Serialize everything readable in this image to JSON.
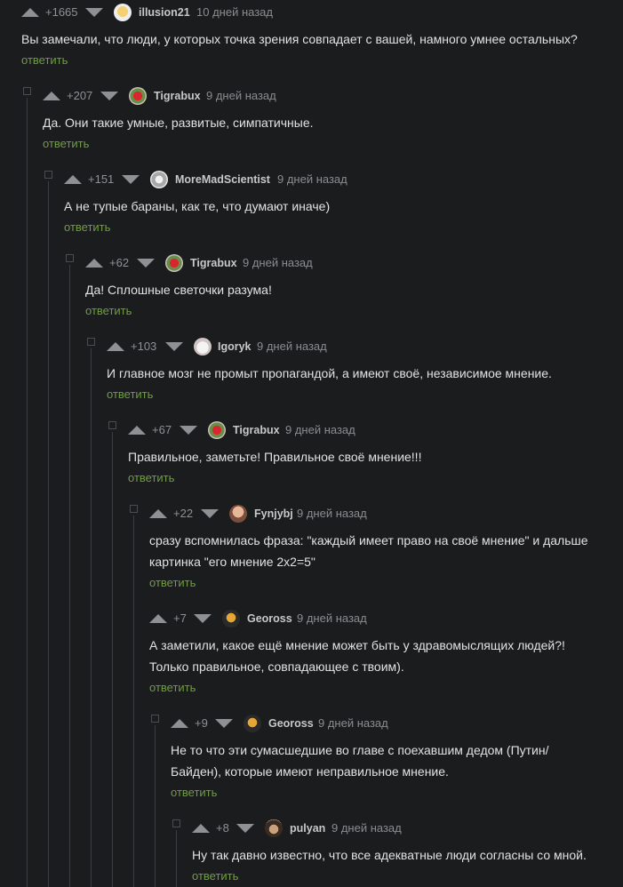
{
  "reply_label": "ответить",
  "comments": [
    {
      "score": "+1665",
      "user": "illusion21",
      "time": "10 дней назад",
      "text": "Вы замечали, что люди, у которых точка зрения совпадает с вашей, намного умнее остальных?",
      "avatar": "sun-avatar"
    },
    {
      "score": "+207",
      "user": "Tigrabux",
      "time": "9 дней назад",
      "text": "Да. Они такие умные, развитые, симпатичные.",
      "avatar": "rose-avatar"
    },
    {
      "score": "+151",
      "user": "MoreMadScientist",
      "time": "9 дней назад",
      "text": "А не тупые бараны, как те, что думают иначе)",
      "avatar": "scientist-avatar"
    },
    {
      "score": "+62",
      "user": "Tigrabux",
      "time": "9 дней назад",
      "text": "Да! Сплошные светочки разума!",
      "avatar": "rose-avatar"
    },
    {
      "score": "+103",
      "user": "Igoryk",
      "time": "9 дней назад",
      "text": "И главное мозг не промыт пропагандой, а имеют своё, независимое мнение.",
      "avatar": "mask-avatar"
    },
    {
      "score": "+67",
      "user": "Tigrabux",
      "time": "9 дней назад",
      "text": "Правильное, заметьте! Правильное своё мнение!!!",
      "avatar": "rose-avatar"
    },
    {
      "score": "+22",
      "user": "Fynjybj",
      "time": "9 дней назад",
      "text": "сразу вспомнилась фраза: \"каждый имеет право на своё мнение\" и дальше картинка \"его мнение 2х2=5\"",
      "avatar": "face-avatar"
    },
    {
      "score": "+7",
      "user": "Geoross",
      "time": "9 дней назад",
      "text": "А заметили, какое ещё мнение может быть у здравомыслящих людей?! Только правильное, совпадающее с твоим).",
      "avatar": "dark-face-avatar"
    },
    {
      "score": "+9",
      "user": "Geoross",
      "time": "9 дней назад",
      "text": "Не то что эти сумасшедшие во главе с поехавшим дедом (Путин/ Байден), которые имеют неправильное мнение.",
      "avatar": "dark-face-avatar"
    },
    {
      "score": "+8",
      "user": "pulyan",
      "time": "9 дней назад",
      "text": "Ну так давно известно, что все адекватные люди согласны со мной.",
      "avatar": "pirate-avatar"
    }
  ]
}
